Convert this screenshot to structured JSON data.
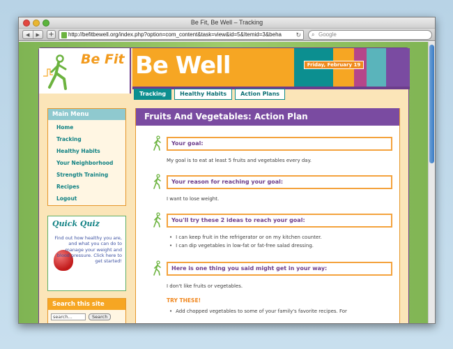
{
  "window": {
    "title": "Be Fit, Be Well – Tracking"
  },
  "toolbar": {
    "url": "http://befitbewell.org/index.php?option=com_content&task=view&id=5&Itemid=3&beha",
    "search_placeholder": "Google",
    "back_glyph": "◀",
    "forward_glyph": "▶",
    "plus_glyph": "+",
    "reload_glyph": "↻",
    "search_glyph": "⌕"
  },
  "header": {
    "logo_befit": "Be Fit",
    "logo_bewell": "Be Well",
    "date": "Friday, February 19",
    "accent_colors": [
      "#0c8f90",
      "#f6a623",
      "#b5468a",
      "#8fc9cf",
      "#7a4ba1"
    ]
  },
  "tabs": [
    {
      "label": "Tracking",
      "active": true
    },
    {
      "label": "Healthy Habits",
      "active": false
    },
    {
      "label": "Action Plans",
      "active": false
    }
  ],
  "sidebar": {
    "menu_title": "Main Menu",
    "items": [
      "Home",
      "Tracking",
      "Healthy Habits",
      "Your Neighborhood",
      "Strength Training",
      "Recipes",
      "Logout"
    ],
    "quiz_title": "Quick Quiz",
    "quiz_text": "Find out how healthy you are, and what you can do to manage your weight and blood pressure. Click here to get started!",
    "search_title": "Search this site",
    "search_placeholder": "search...",
    "search_button": "Search"
  },
  "content": {
    "title": "Fruits And Vegetables: Action Plan",
    "goal_heading": "Your goal:",
    "goal_text": "My goal is to eat at least 5 fruits and vegetables every day.",
    "reason_heading": "Your reason for reaching your goal:",
    "reason_text": "I want to lose weight.",
    "ideas_heading": "You'll try these 2 ideas to reach your goal:",
    "ideas": [
      "I can keep fruit in the refrigerator or on my kitchen counter.",
      "I can dip vegetables in low-fat or fat-free salad dressing."
    ],
    "barrier_heading": "Here is one thing you said might get in your way:",
    "barrier_text": "I don't like fruits or vegetables.",
    "try_label": "TRY THESE!",
    "try_items": [
      "Add chopped vegetables to some of your family's favorite recipes. For"
    ]
  }
}
